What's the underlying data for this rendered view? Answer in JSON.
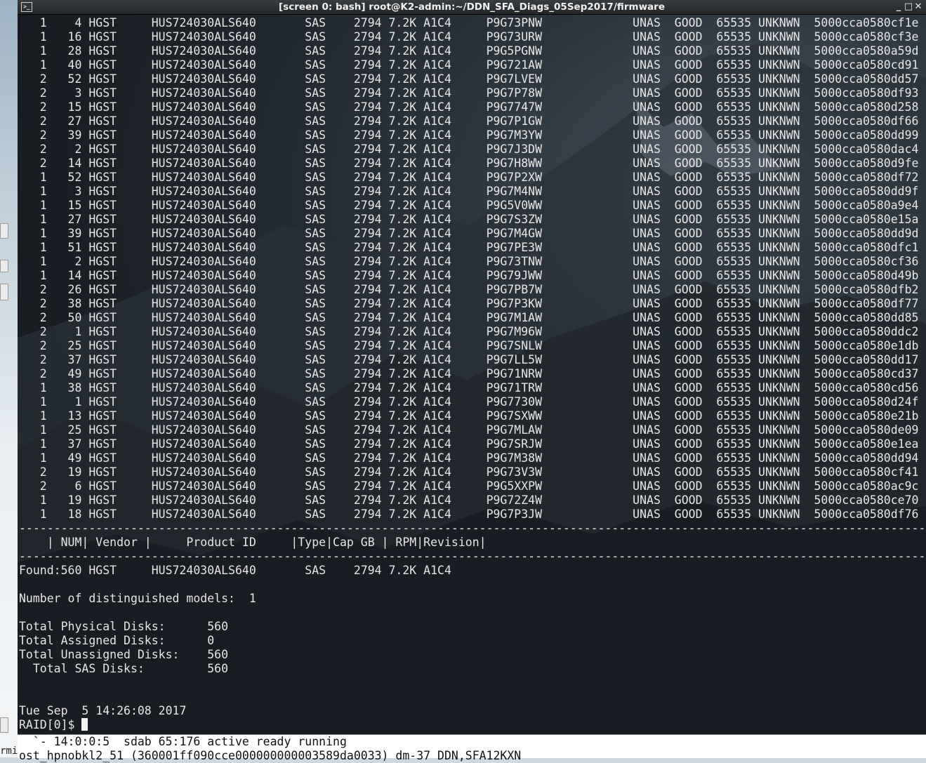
{
  "window": {
    "title": "[screen 0: bash] root@K2-admin:~/DDN_SFA_Diags_05Sep2017/firmware",
    "icon_glyph": ">_",
    "minimize_glyph": "_",
    "maximize_glyph": "□",
    "close_glyph": "✕"
  },
  "left_strip": {
    "label": "rmi"
  },
  "terminal": {
    "lines": [
      "   1    4 HGST     HUS724030ALS640       SAS    2794 7.2K A1C4     P9G73PNW             UNAS  GOOD  65535 UNKNWN  5000cca0580cf1e",
      "   1   16 HGST     HUS724030ALS640       SAS    2794 7.2K A1C4     P9G73URW             UNAS  GOOD  65535 UNKNWN  5000cca0580cf3e",
      "   1   28 HGST     HUS724030ALS640       SAS    2794 7.2K A1C4     P9G5PGNW             UNAS  GOOD  65535 UNKNWN  5000cca0580a59d",
      "   1   40 HGST     HUS724030ALS640       SAS    2794 7.2K A1C4     P9G721AW             UNAS  GOOD  65535 UNKNWN  5000cca0580cd91",
      "   2   52 HGST     HUS724030ALS640       SAS    2794 7.2K A1C4     P9G7LVEW             UNAS  GOOD  65535 UNKNWN  5000cca0580dd57",
      "   2    3 HGST     HUS724030ALS640       SAS    2794 7.2K A1C4     P9G7P78W             UNAS  GOOD  65535 UNKNWN  5000cca0580df93",
      "   2   15 HGST     HUS724030ALS640       SAS    2794 7.2K A1C4     P9G7747W             UNAS  GOOD  65535 UNKNWN  5000cca0580d258",
      "   2   27 HGST     HUS724030ALS640       SAS    2794 7.2K A1C4     P9G7P1GW             UNAS  GOOD  65535 UNKNWN  5000cca0580df66",
      "   2   39 HGST     HUS724030ALS640       SAS    2794 7.2K A1C4     P9G7M3YW             UNAS  GOOD  65535 UNKNWN  5000cca0580dd99",
      "   2    2 HGST     HUS724030ALS640       SAS    2794 7.2K A1C4     P9G7J3DW             UNAS  GOOD  65535 UNKNWN  5000cca0580dac4",
      "   2   14 HGST     HUS724030ALS640       SAS    2794 7.2K A1C4     P9G7H8WW             UNAS  GOOD  65535 UNKNWN  5000cca0580d9fe",
      "   1   52 HGST     HUS724030ALS640       SAS    2794 7.2K A1C4     P9G7P2XW             UNAS  GOOD  65535 UNKNWN  5000cca0580df72",
      "   1    3 HGST     HUS724030ALS640       SAS    2794 7.2K A1C4     P9G7M4NW             UNAS  GOOD  65535 UNKNWN  5000cca0580dd9f",
      "   1   15 HGST     HUS724030ALS640       SAS    2794 7.2K A1C4     P9G5V0WW             UNAS  GOOD  65535 UNKNWN  5000cca0580a9e4",
      "   1   27 HGST     HUS724030ALS640       SAS    2794 7.2K A1C4     P9G7S3ZW             UNAS  GOOD  65535 UNKNWN  5000cca0580e15a",
      "   1   39 HGST     HUS724030ALS640       SAS    2794 7.2K A1C4     P9G7M4GW             UNAS  GOOD  65535 UNKNWN  5000cca0580dd9d",
      "   1   51 HGST     HUS724030ALS640       SAS    2794 7.2K A1C4     P9G7PE3W             UNAS  GOOD  65535 UNKNWN  5000cca0580dfc1",
      "   1    2 HGST     HUS724030ALS640       SAS    2794 7.2K A1C4     P9G73TNW             UNAS  GOOD  65535 UNKNWN  5000cca0580cf36",
      "   1   14 HGST     HUS724030ALS640       SAS    2794 7.2K A1C4     P9G79JWW             UNAS  GOOD  65535 UNKNWN  5000cca0580d49b",
      "   2   26 HGST     HUS724030ALS640       SAS    2794 7.2K A1C4     P9G7PB7W             UNAS  GOOD  65535 UNKNWN  5000cca0580dfb2",
      "   2   38 HGST     HUS724030ALS640       SAS    2794 7.2K A1C4     P9G7P3KW             UNAS  GOOD  65535 UNKNWN  5000cca0580df77",
      "   2   50 HGST     HUS724030ALS640       SAS    2794 7.2K A1C4     P9G7M1AW             UNAS  GOOD  65535 UNKNWN  5000cca0580dd85",
      "   2    1 HGST     HUS724030ALS640       SAS    2794 7.2K A1C4     P9G7M96W             UNAS  GOOD  65535 UNKNWN  5000cca0580ddc2",
      "   2   25 HGST     HUS724030ALS640       SAS    2794 7.2K A1C4     P9G7SNLW             UNAS  GOOD  65535 UNKNWN  5000cca0580e1db",
      "   2   37 HGST     HUS724030ALS640       SAS    2794 7.2K A1C4     P9G7LL5W             UNAS  GOOD  65535 UNKNWN  5000cca0580dd17",
      "   2   49 HGST     HUS724030ALS640       SAS    2794 7.2K A1C4     P9G71NRW             UNAS  GOOD  65535 UNKNWN  5000cca0580cd37",
      "   1   38 HGST     HUS724030ALS640       SAS    2794 7.2K A1C4     P9G71TRW             UNAS  GOOD  65535 UNKNWN  5000cca0580cd56",
      "   1    1 HGST     HUS724030ALS640       SAS    2794 7.2K A1C4     P9G7730W             UNAS  GOOD  65535 UNKNWN  5000cca0580d24f",
      "   1   13 HGST     HUS724030ALS640       SAS    2794 7.2K A1C4     P9G7SXWW             UNAS  GOOD  65535 UNKNWN  5000cca0580e21b",
      "   1   25 HGST     HUS724030ALS640       SAS    2794 7.2K A1C4     P9G7MLAW             UNAS  GOOD  65535 UNKNWN  5000cca0580de09",
      "   1   37 HGST     HUS724030ALS640       SAS    2794 7.2K A1C4     P9G7SRJW             UNAS  GOOD  65535 UNKNWN  5000cca0580e1ea",
      "   1   49 HGST     HUS724030ALS640       SAS    2794 7.2K A1C4     P9G7M38W             UNAS  GOOD  65535 UNKNWN  5000cca0580dd94",
      "   2   19 HGST     HUS724030ALS640       SAS    2794 7.2K A1C4     P9G73V3W             UNAS  GOOD  65535 UNKNWN  5000cca0580cf41",
      "   2    6 HGST     HUS724030ALS640       SAS    2794 7.2K A1C4     P9G5XXPW             UNAS  GOOD  65535 UNKNWN  5000cca0580ac9c",
      "   1   19 HGST     HUS724030ALS640       SAS    2794 7.2K A1C4     P9G72Z4W             UNAS  GOOD  65535 UNKNWN  5000cca0580ce70",
      "   1   18 HGST     HUS724030ALS640       SAS    2794 7.2K A1C4     P9G7P3JW             UNAS  GOOD  65535 UNKNWN  5000cca0580df76",
      "-------------------------------------------------------------------------------------------------------------------------------------",
      "    | NUM| Vendor |     Product ID     |Type|Cap GB | RPM|Revision|",
      "-------------------------------------------------------------------------------------------------------------------------------------",
      "Found:560 HGST     HUS724030ALS640       SAS    2794 7.2K A1C4",
      "",
      "Number of distinguished models:  1",
      "",
      "Total Physical Disks:      560",
      "Total Assigned Disks:      0",
      "Total Unassigned Disks:    560",
      "  Total SAS Disks:         560",
      "",
      "",
      "Tue Sep  5 14:26:08 2017"
    ],
    "prompt": "RAID[0]$ "
  },
  "bottom_terminal": {
    "lines": [
      "  `- 14:0:0:5  sdab 65:176 active ready running",
      "ost_hpnobkl2_51 (360001ff090cce000000000003589da0033) dm-37 DDN,SFA12KXN"
    ]
  }
}
